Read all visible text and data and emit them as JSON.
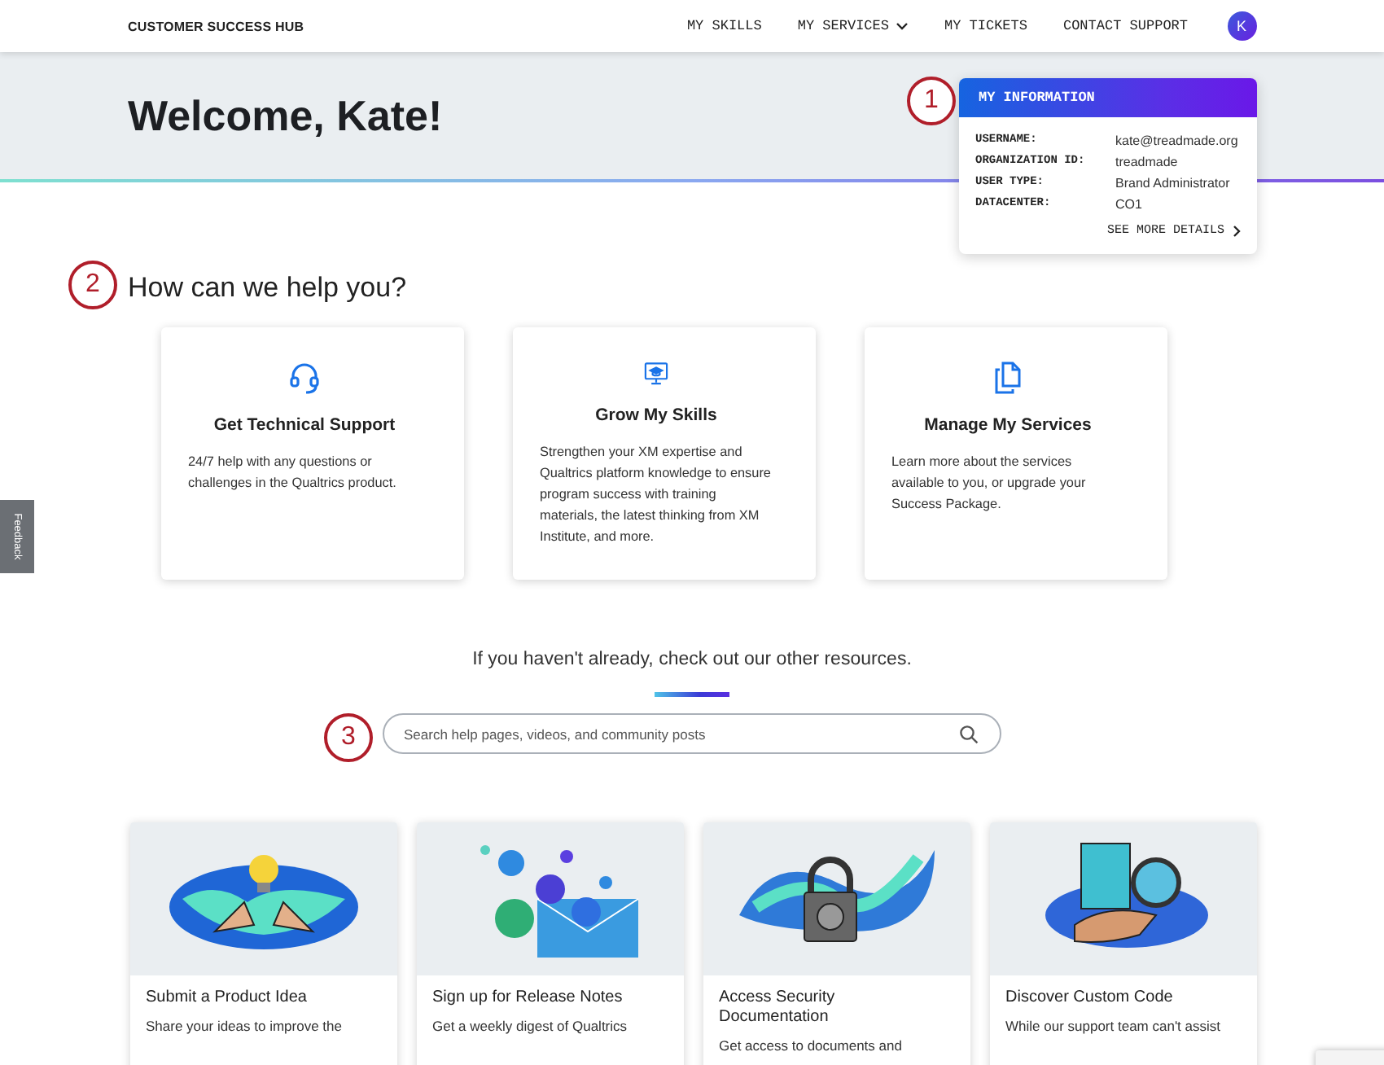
{
  "header": {
    "brand": "CUSTOMER SUCCESS HUB",
    "nav": [
      {
        "label": "MY SKILLS",
        "dropdown": false
      },
      {
        "label": "MY SERVICES",
        "dropdown": true
      },
      {
        "label": "MY TICKETS",
        "dropdown": false
      },
      {
        "label": "CONTACT SUPPORT",
        "dropdown": false
      }
    ],
    "avatar": "K"
  },
  "hero": {
    "title": "Welcome, Kate!"
  },
  "info_card": {
    "title": "MY INFORMATION",
    "fields": [
      {
        "label": "USERNAME:",
        "value": "kate@treadmade.org"
      },
      {
        "label": "ORGANIZATION ID:",
        "value": "treadmade"
      },
      {
        "label": "USER TYPE:",
        "value": "Brand Administrator"
      },
      {
        "label": "DATACENTER:",
        "value": "CO1"
      }
    ],
    "link": "SEE MORE DETAILS"
  },
  "help": {
    "heading": "How can we help you?",
    "cards": [
      {
        "kind": "headset",
        "title": "Get Technical Support",
        "text": "24/7 help with any questions or challenges in the Qualtrics product."
      },
      {
        "kind": "monitor",
        "title": "Grow My Skills",
        "text": "Strengthen your XM expertise and Qualtrics platform knowledge to ensure program success with training materials, the latest thinking from XM Institute, and more."
      },
      {
        "kind": "documents",
        "title": "Manage My Services",
        "text": "Learn more about the services available to you, or upgrade your Success Package."
      }
    ]
  },
  "resources": {
    "intro": "If you haven't already, check out our other resources.",
    "search": {
      "placeholder": "Search help pages, videos, and community posts"
    },
    "cards": [
      {
        "kind": "idea",
        "title": "Submit a Product Idea",
        "text": "Share your ideas to improve the"
      },
      {
        "kind": "notes",
        "title": "Sign up for Release Notes",
        "text": "Get a weekly digest of Qualtrics"
      },
      {
        "kind": "security",
        "title": "Access Security Documentation",
        "text": "Get access to documents and"
      },
      {
        "kind": "code",
        "title": "Discover Custom Code",
        "text": "While our support team can't assist"
      }
    ]
  },
  "callouts": [
    "1",
    "2",
    "3"
  ],
  "feedback_tab": "Feedback"
}
